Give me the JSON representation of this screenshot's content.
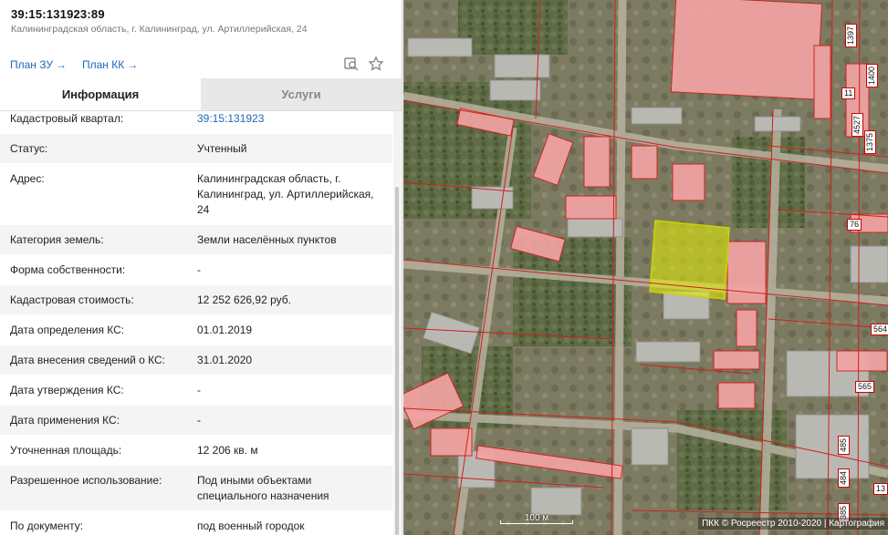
{
  "header": {
    "title": "39:15:131923:89",
    "address": "Калининградская область, г. Калининград, ул. Артиллерийская, 24",
    "plan_zu_label": "План ЗУ",
    "plan_kk_label": "План КК",
    "arrow": "→"
  },
  "tabs": [
    {
      "label": "Информация",
      "active": true
    },
    {
      "label": "Услуги",
      "active": false
    }
  ],
  "rows": [
    {
      "label": "Кадастровый квартал:",
      "value": [
        "39:15:131923"
      ],
      "link": true
    },
    {
      "label": "Статус:",
      "value": [
        "Учтенный"
      ]
    },
    {
      "label": "Адрес:",
      "value": [
        "Калининградская область, г.",
        "Калининград, ул. Артиллерийская,",
        "24"
      ]
    },
    {
      "label": "Категория земель:",
      "value": [
        "Земли населённых пунктов"
      ]
    },
    {
      "label": "Форма собственности:",
      "value": [
        "-"
      ]
    },
    {
      "label": "Кадастровая стоимость:",
      "value": [
        "12 252 626,92 руб."
      ]
    },
    {
      "label": "Дата определения КС:",
      "value": [
        "01.01.2019"
      ]
    },
    {
      "label": "Дата внесения сведений о КС:",
      "value": [
        "31.01.2020"
      ]
    },
    {
      "label": "Дата утверждения КС:",
      "value": [
        "-"
      ]
    },
    {
      "label": "Дата применения КС:",
      "value": [
        "-"
      ]
    },
    {
      "label": "Уточненная площадь:",
      "value": [
        "12 206 кв. м"
      ]
    },
    {
      "label": "Разрешенное использование:",
      "value": [
        "Под иными объектами",
        "специального назначения"
      ]
    },
    {
      "label": "По документу:",
      "value": [
        "под военный городок"
      ]
    }
  ],
  "map": {
    "labels": [
      "1397",
      "11",
      "1400",
      "4527",
      "1375",
      "76",
      "564",
      "565",
      "485",
      "484",
      "385",
      "13"
    ],
    "scale_label": "100 м",
    "credit": "ПКК © Росреестр 2010-2020 | Картография"
  },
  "colors": {
    "link": "#1f66b8",
    "selected_parcel": "#e6f000",
    "parcel_border": "#d0201a",
    "building_pink": "#f2a3a3"
  }
}
